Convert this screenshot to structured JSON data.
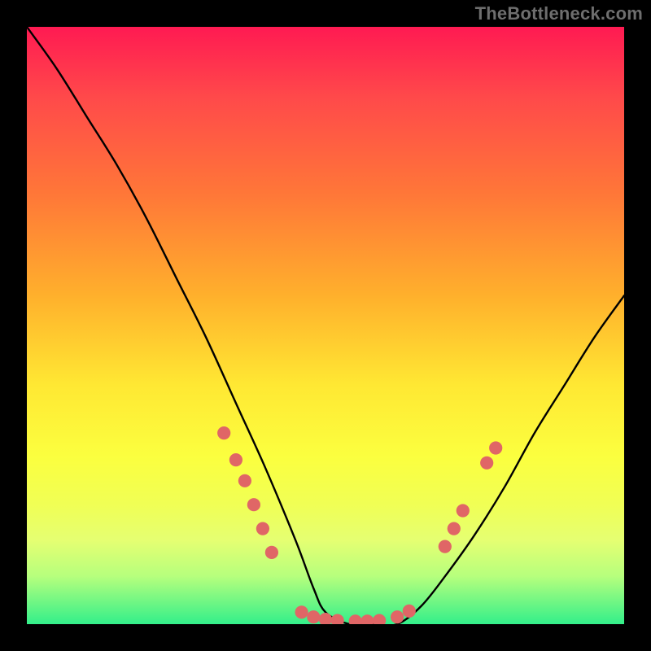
{
  "watermark": "TheBottleneck.com",
  "chart_data": {
    "type": "line",
    "title": "",
    "xlabel": "",
    "ylabel": "",
    "xlim": [
      0,
      100
    ],
    "ylim": [
      0,
      100
    ],
    "grid": false,
    "legend": false,
    "series": [
      {
        "name": "curve",
        "color": "#000000",
        "x": [
          0,
          5,
          10,
          15,
          20,
          25,
          30,
          35,
          40,
          45,
          48,
          50,
          54,
          58,
          62,
          66,
          70,
          75,
          80,
          85,
          90,
          95,
          100
        ],
        "y": [
          100,
          93,
          85,
          77,
          68,
          58,
          48,
          37,
          26,
          14,
          6,
          2,
          0,
          0,
          0,
          3,
          8,
          15,
          23,
          32,
          40,
          48,
          55
        ]
      }
    ],
    "markers": {
      "name": "threshold-dots",
      "color": "#e06666",
      "radius_pct": 1.1,
      "points": [
        {
          "x": 33.0,
          "y": 32.0
        },
        {
          "x": 35.0,
          "y": 27.5
        },
        {
          "x": 36.5,
          "y": 24.0
        },
        {
          "x": 38.0,
          "y": 20.0
        },
        {
          "x": 39.5,
          "y": 16.0
        },
        {
          "x": 41.0,
          "y": 12.0
        },
        {
          "x": 46.0,
          "y": 2.0
        },
        {
          "x": 48.0,
          "y": 1.2
        },
        {
          "x": 50.0,
          "y": 0.8
        },
        {
          "x": 52.0,
          "y": 0.6
        },
        {
          "x": 55.0,
          "y": 0.5
        },
        {
          "x": 57.0,
          "y": 0.5
        },
        {
          "x": 59.0,
          "y": 0.6
        },
        {
          "x": 62.0,
          "y": 1.2
        },
        {
          "x": 64.0,
          "y": 2.2
        },
        {
          "x": 70.0,
          "y": 13.0
        },
        {
          "x": 71.5,
          "y": 16.0
        },
        {
          "x": 73.0,
          "y": 19.0
        },
        {
          "x": 77.0,
          "y": 27.0
        },
        {
          "x": 78.5,
          "y": 29.5
        }
      ]
    },
    "gradient_colors": {
      "top": "#ff1a52",
      "mid": "#ffe833",
      "bottom": "#33ef8a"
    }
  }
}
